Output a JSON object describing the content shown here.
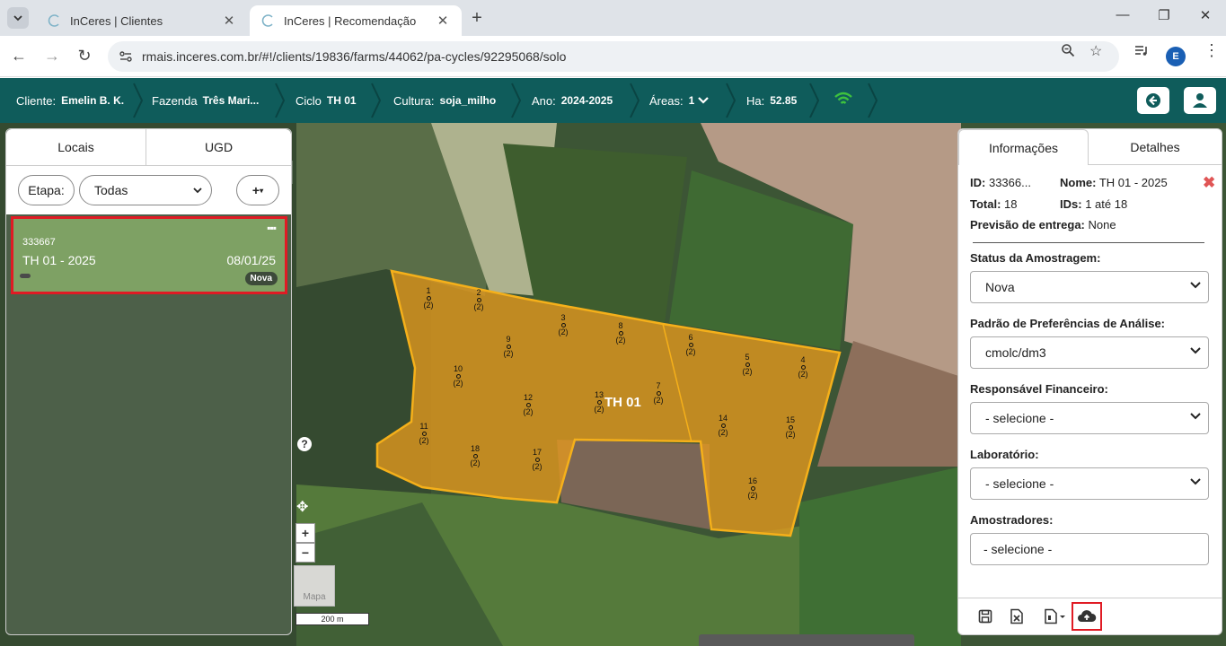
{
  "browser": {
    "tabs": [
      {
        "title": "InCeres | Clientes",
        "active": false
      },
      {
        "title": "InCeres | Recomendação",
        "active": true
      }
    ],
    "url": "rmais.inceres.com.br/#!/clients/19836/farms/44062/pa-cycles/92295068/solo",
    "profile_initial": "E"
  },
  "header": {
    "cliente_label": "Cliente:",
    "cliente_value": "Emelin B. K.",
    "fazenda_label": "Fazenda",
    "fazenda_value": "Três Mari...",
    "ciclo_label": "Ciclo",
    "ciclo_value": "TH 01",
    "cultura_label": "Cultura:",
    "cultura_value": "soja_milho",
    "ano_label": "Ano:",
    "ano_value": "2024-2025",
    "areas_label": "Áreas:",
    "areas_value": "1",
    "ha_label": "Ha:",
    "ha_value": "52.85"
  },
  "left_panel": {
    "tabs": [
      "Locais",
      "UGD"
    ],
    "etapa_label": "Etapa:",
    "etapa_value": "Todas",
    "add_label": "+",
    "card": {
      "id": "333667",
      "name": "TH 01 - 2025",
      "date": "08/01/25",
      "badge": "Nova"
    }
  },
  "map": {
    "field_label": "TH 01",
    "points": [
      {
        "n": "1",
        "c": "(2)"
      },
      {
        "n": "2",
        "c": "(2)"
      },
      {
        "n": "3",
        "c": "(2)"
      },
      {
        "n": "4",
        "c": "(2)"
      },
      {
        "n": "5",
        "c": "(2)"
      },
      {
        "n": "6",
        "c": "(2)"
      },
      {
        "n": "7",
        "c": "(2)"
      },
      {
        "n": "8",
        "c": "(2)"
      },
      {
        "n": "9",
        "c": "(2)"
      },
      {
        "n": "10",
        "c": "(2)"
      },
      {
        "n": "11",
        "c": "(2)"
      },
      {
        "n": "12",
        "c": "(2)"
      },
      {
        "n": "13",
        "c": "(2)"
      },
      {
        "n": "14",
        "c": "(2)"
      },
      {
        "n": "15",
        "c": "(2)"
      },
      {
        "n": "16",
        "c": "(2)"
      },
      {
        "n": "17",
        "c": "(2)"
      },
      {
        "n": "18",
        "c": "(2)"
      }
    ],
    "help": "?",
    "zoom_in": "+",
    "zoom_out": "−",
    "basemap_label": "Mapa",
    "scale_label": "200 m"
  },
  "right_panel": {
    "tabs": [
      "Informações",
      "Detalhes"
    ],
    "id_label": "ID:",
    "id_value": "33366...",
    "nome_label": "Nome:",
    "nome_value": "TH 01 - 2025",
    "total_label": "Total:",
    "total_value": "18",
    "ids_label": "IDs:",
    "ids_value": "1 até 18",
    "previsao_label": "Previsão de entrega:",
    "previsao_value": "None",
    "status_label": "Status da Amostragem:",
    "status_value": "Nova",
    "padrao_label": "Padrão de Preferências de Análise:",
    "padrao_value": "cmolc/dm3",
    "resp_label": "Responsável Financeiro:",
    "resp_value": "- selecione -",
    "lab_label": "Laboratório:",
    "lab_value": "- selecione -",
    "amostradores_label": "Amostradores:",
    "amostradores_value": "- selecione -"
  },
  "colors": {
    "header_bg": "#0f5c5b",
    "field_fill": "#e59a1e",
    "highlight": "#e01b24",
    "wifi": "#3ec23e"
  }
}
